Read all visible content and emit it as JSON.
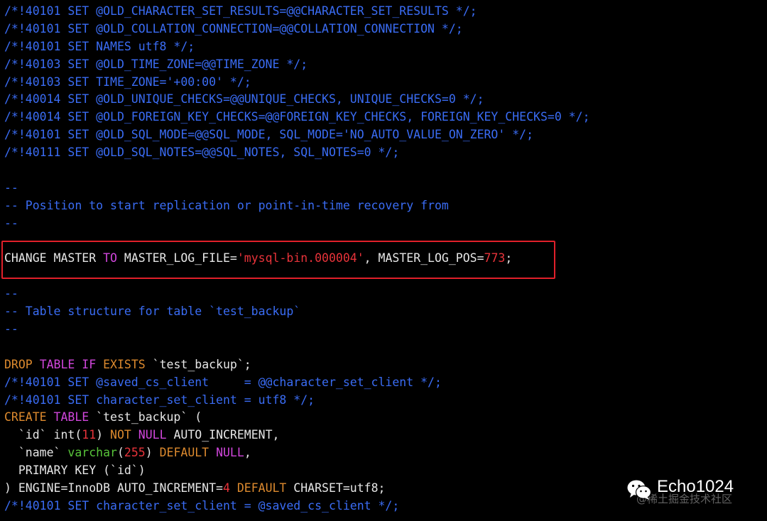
{
  "colors": {
    "background": "#000000",
    "comment": "#3a6cf4",
    "keyword_red": "#e8333a",
    "keyword_orange": "#dd8a2e",
    "keyword_magenta": "#d146dc",
    "type_green": "#58c43a",
    "text": "#e6e6e6",
    "highlight_box": "#e0202a"
  },
  "lines": [
    [
      {
        "t": "/*!40101 SET @OLD_CHARACTER_SET_RESULTS=@@CHARACTER_SET_RESULTS */;",
        "c": "comment"
      }
    ],
    [
      {
        "t": "/*!40101 SET @OLD_COLLATION_CONNECTION=@@COLLATION_CONNECTION */;",
        "c": "comment"
      }
    ],
    [
      {
        "t": "/*!40101 SET NAMES utf8 */;",
        "c": "comment"
      }
    ],
    [
      {
        "t": "/*!40103 SET @OLD_TIME_ZONE=@@TIME_ZONE */;",
        "c": "comment"
      }
    ],
    [
      {
        "t": "/*!40103 SET TIME_ZONE='+00:00' */;",
        "c": "comment"
      }
    ],
    [
      {
        "t": "/*!40014 SET @OLD_UNIQUE_CHECKS=@@UNIQUE_CHECKS, UNIQUE_CHECKS=0 */;",
        "c": "comment"
      }
    ],
    [
      {
        "t": "/*!40014 SET @OLD_FOREIGN_KEY_CHECKS=@@FOREIGN_KEY_CHECKS, FOREIGN_KEY_CHECKS=0 */;",
        "c": "comment"
      }
    ],
    [
      {
        "t": "/*!40101 SET @OLD_SQL_MODE=@@SQL_MODE, SQL_MODE='NO_AUTO_VALUE_ON_ZERO' */;",
        "c": "comment"
      }
    ],
    [
      {
        "t": "/*!40111 SET @OLD_SQL_NOTES=@@SQL_NOTES, SQL_NOTES=0 */;",
        "c": "comment"
      }
    ],
    [],
    [
      {
        "t": "--",
        "c": "comment"
      }
    ],
    [
      {
        "t": "-- Position to start replication or point-in-time recovery from",
        "c": "comment"
      }
    ],
    [
      {
        "t": "--",
        "c": "comment"
      }
    ],
    [],
    [
      {
        "t": "CHANGE MASTER ",
        "c": "white"
      },
      {
        "t": "TO",
        "c": "magenta"
      },
      {
        "t": " MASTER_LOG_FILE=",
        "c": "white"
      },
      {
        "t": "'mysql-bin.000004'",
        "c": "red"
      },
      {
        "t": ", MASTER_LOG_POS=",
        "c": "white"
      },
      {
        "t": "773",
        "c": "red"
      },
      {
        "t": ";",
        "c": "white"
      }
    ],
    [],
    [
      {
        "t": "--",
        "c": "comment"
      }
    ],
    [
      {
        "t": "-- Table structure for table `test_backup`",
        "c": "comment"
      }
    ],
    [
      {
        "t": "--",
        "c": "comment"
      }
    ],
    [],
    [
      {
        "t": "DROP",
        "c": "orange"
      },
      {
        "t": " ",
        "c": "white"
      },
      {
        "t": "TABLE",
        "c": "magenta"
      },
      {
        "t": " ",
        "c": "white"
      },
      {
        "t": "IF",
        "c": "magenta"
      },
      {
        "t": " ",
        "c": "white"
      },
      {
        "t": "EXISTS",
        "c": "orange"
      },
      {
        "t": " `test_backup`;",
        "c": "white"
      }
    ],
    [
      {
        "t": "/*!40101 SET @saved_cs_client     = @@character_set_client */;",
        "c": "comment"
      }
    ],
    [
      {
        "t": "/*!40101 SET character_set_client = utf8 */;",
        "c": "comment"
      }
    ],
    [
      {
        "t": "CREATE",
        "c": "orange"
      },
      {
        "t": " ",
        "c": "white"
      },
      {
        "t": "TABLE",
        "c": "magenta"
      },
      {
        "t": " `test_backup` (",
        "c": "white"
      }
    ],
    [
      {
        "t": "  `id` int(",
        "c": "white"
      },
      {
        "t": "11",
        "c": "red"
      },
      {
        "t": ") ",
        "c": "white"
      },
      {
        "t": "NOT",
        "c": "orange"
      },
      {
        "t": " ",
        "c": "white"
      },
      {
        "t": "NULL",
        "c": "magenta"
      },
      {
        "t": " AUTO_INCREMENT,",
        "c": "white"
      }
    ],
    [
      {
        "t": "  `name` ",
        "c": "white"
      },
      {
        "t": "varchar",
        "c": "green"
      },
      {
        "t": "(",
        "c": "white"
      },
      {
        "t": "255",
        "c": "red"
      },
      {
        "t": ") ",
        "c": "white"
      },
      {
        "t": "DEFAULT",
        "c": "orange"
      },
      {
        "t": " ",
        "c": "white"
      },
      {
        "t": "NULL",
        "c": "magenta"
      },
      {
        "t": ",",
        "c": "white"
      }
    ],
    [
      {
        "t": "  PRIMARY KEY (`id`)",
        "c": "white"
      }
    ],
    [
      {
        "t": ") ENGINE=InnoDB AUTO_INCREMENT=",
        "c": "white"
      },
      {
        "t": "4",
        "c": "red"
      },
      {
        "t": " ",
        "c": "white"
      },
      {
        "t": "DEFAULT",
        "c": "orange"
      },
      {
        "t": " CHARSET=utf8;",
        "c": "white"
      }
    ],
    [
      {
        "t": "/*!40101 SET character_set_client = @saved_cs_client */;",
        "c": "comment"
      }
    ]
  ],
  "watermark": {
    "icon": "wechat-icon",
    "name": "Echo1024",
    "subtext": "@稀土掘金技术社区"
  }
}
